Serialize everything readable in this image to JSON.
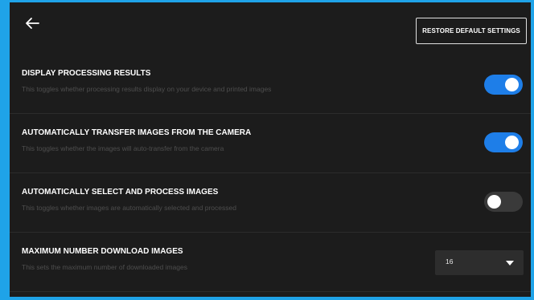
{
  "header": {
    "back_icon": "back-arrow-icon",
    "restore_label": "RESTORE DEFAULT SETTINGS"
  },
  "settings": [
    {
      "title": "DISPLAY PROCESSING RESULTS",
      "description": "This toggles whether processing results display on your device and printed images",
      "control": "toggle",
      "enabled": true
    },
    {
      "title": "AUTOMATICALLY TRANSFER IMAGES FROM THE CAMERA",
      "description": "This toggles whether the images will auto-transfer from the camera",
      "control": "toggle",
      "enabled": true
    },
    {
      "title": "AUTOMATICALLY SELECT AND PROCESS IMAGES",
      "description": "This toggles whether images are automatically selected and processed",
      "control": "toggle",
      "enabled": false
    },
    {
      "title": "MAXIMUM NUMBER DOWNLOAD IMAGES",
      "description": "This sets the maximum number of downloaded images",
      "control": "select",
      "value": "16"
    }
  ],
  "colors": {
    "accent": "#1e7ee8",
    "background": "#1c1c1c",
    "frame_border": "#1fa3e8"
  }
}
